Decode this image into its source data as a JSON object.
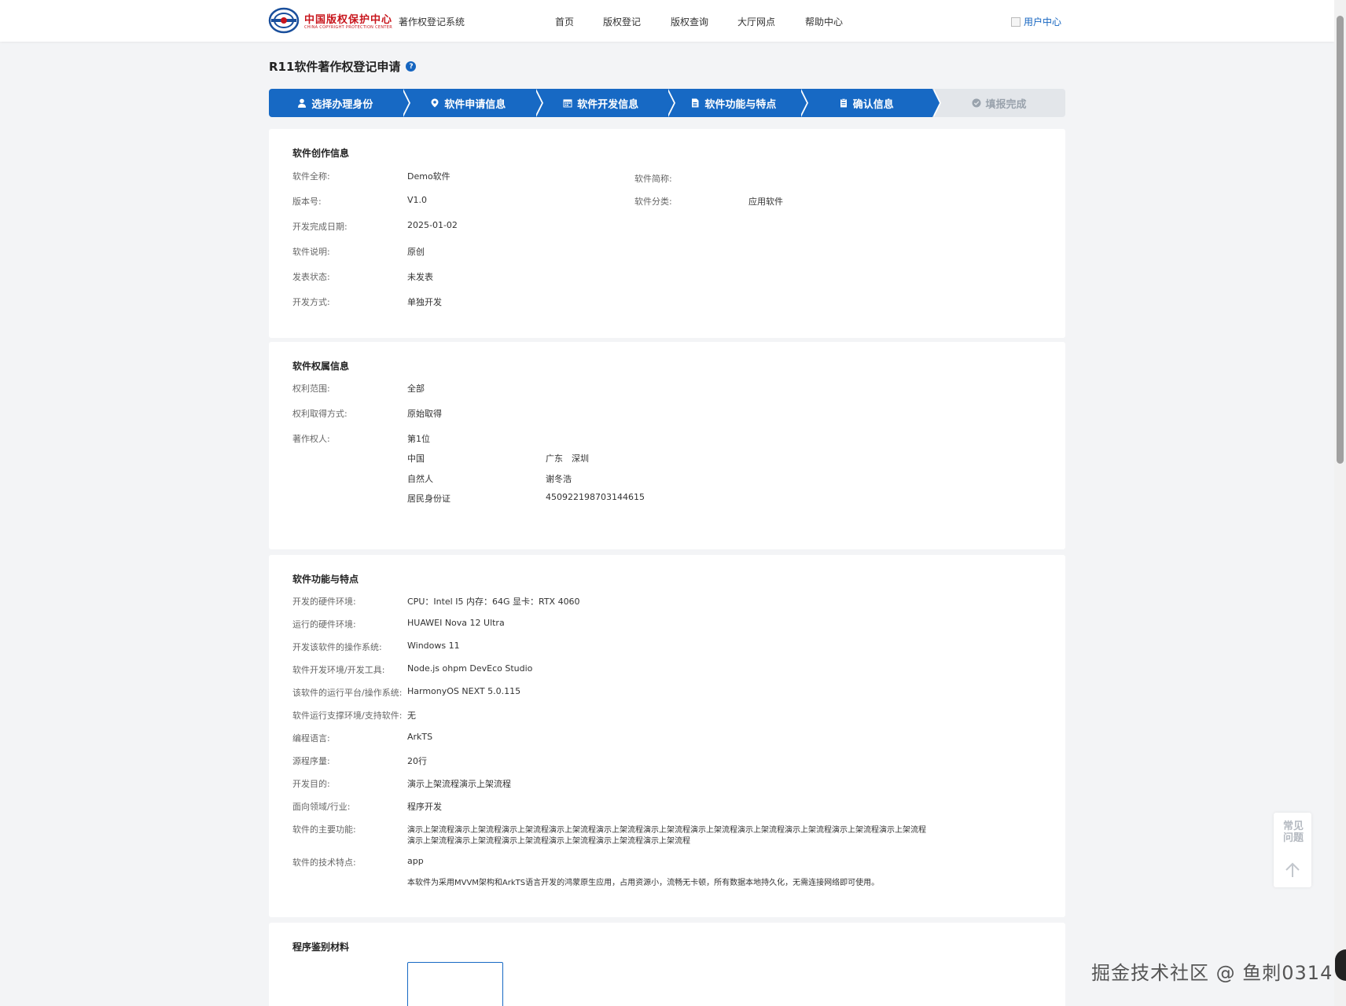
{
  "header": {
    "logo_cn": "中国版权保护中心",
    "logo_en": "CHINA COPYRIGHT PROTECTION CENTER",
    "system_name": "著作权登记系统",
    "nav": [
      "首页",
      "版权登记",
      "版权查询",
      "大厅网点",
      "帮助中心"
    ],
    "user_center": "用户中心"
  },
  "page": {
    "title": "R11软件著作权登记申请",
    "help": "?"
  },
  "steps": [
    {
      "label": "选择办理身份",
      "icon": "user-icon",
      "state": "active"
    },
    {
      "label": "软件申请信息",
      "icon": "location-icon",
      "state": "active"
    },
    {
      "label": "软件开发信息",
      "icon": "calendar-icon",
      "state": "active"
    },
    {
      "label": "软件功能与特点",
      "icon": "document-icon",
      "state": "active"
    },
    {
      "label": "确认信息",
      "icon": "clipboard-icon",
      "state": "active"
    },
    {
      "label": "填报完成",
      "icon": "check-circle-icon",
      "state": "inactive"
    }
  ],
  "creation": {
    "title": "软件创作信息",
    "full_name_label": "软件全称:",
    "full_name": "Demo软件",
    "short_name_label": "软件简称:",
    "version_label": "版本号:",
    "version": "V1.0",
    "category_label": "软件分类:",
    "category": "应用软件",
    "date_label": "开发完成日期:",
    "date": "2025-01-02",
    "desc_label": "软件说明:",
    "desc": "原创",
    "publish_label": "发表状态:",
    "publish": "未发表",
    "method_label": "开发方式:",
    "method": "单独开发"
  },
  "ownership": {
    "title": "软件权属信息",
    "scope_label": "权利范围:",
    "scope": "全部",
    "acquire_label": "权利取得方式:",
    "acquire": "原始取得",
    "owner_label": "著作权人:",
    "owner_rank": "第1位",
    "country": "中国",
    "region": "广东　深圳",
    "person_type": "自然人",
    "person_name": "谢冬浩",
    "id_type": "居民身份证",
    "id_number": "450922198703144615"
  },
  "features": {
    "title": "软件功能与特点",
    "rows": [
      {
        "label": "开发的硬件环境:",
        "value": "CPU：Intel I5 内存：64G 显卡：RTX 4060"
      },
      {
        "label": "运行的硬件环境:",
        "value": "HUAWEI Nova 12 Ultra"
      },
      {
        "label": "开发该软件的操作系统:",
        "value": "Windows 11"
      },
      {
        "label": "软件开发环境/开发工具:",
        "value": "Node.js ohpm DevEco Studio"
      },
      {
        "label": "该软件的运行平台/操作系统:",
        "value": "HarmonyOS NEXT 5.0.115"
      },
      {
        "label": "软件运行支撑环境/支持软件:",
        "value": "无"
      },
      {
        "label": "编程语言:",
        "value": "ArkTS"
      },
      {
        "label": "源程序量:",
        "value": "20行"
      },
      {
        "label": "开发目的:",
        "value": "演示上架流程演示上架流程"
      },
      {
        "label": "面向领域/行业:",
        "value": "程序开发"
      }
    ],
    "main_label": "软件的主要功能:",
    "main_line1": "演示上架流程演示上架流程演示上架流程演示上架流程演示上架流程演示上架流程演示上架流程演示上架流程演示上架流程演示上架流程演示上架流程",
    "main_line2": "演示上架流程演示上架流程演示上架流程演示上架流程演示上架流程演示上架流程",
    "tech_label": "软件的技术特点:",
    "tech_value": "app",
    "tech_desc": "本软件为采用MVVM架构和ArkTS语言开发的鸿蒙原生应用，占用资源小，流畅无卡顿，所有数据本地持久化，无需连接网络即可使用。"
  },
  "materials": {
    "title": "程序鉴别材料"
  },
  "faq": "常见问题",
  "watermark": "掘金技术社区 @ 鱼刺0314"
}
